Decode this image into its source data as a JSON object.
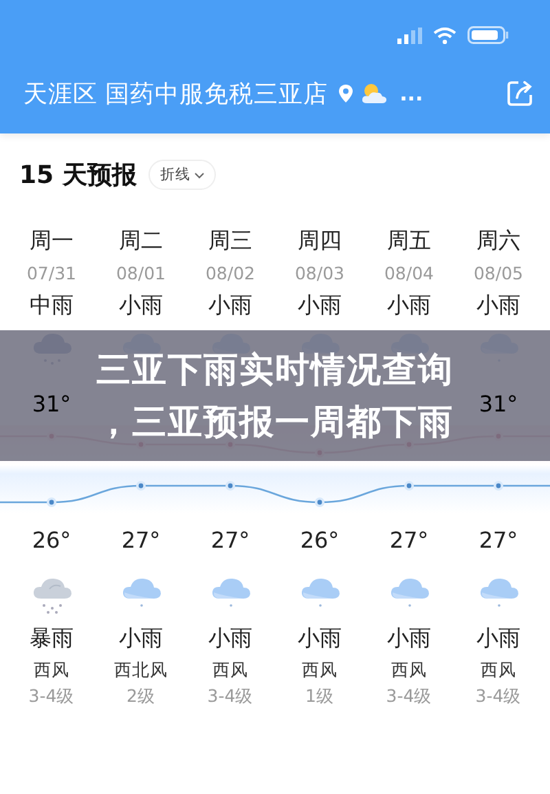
{
  "header": {
    "location": "天涯区 国药中服免税三亚店",
    "more": "..."
  },
  "forecast": {
    "title": "15 天预报",
    "mode": "折线",
    "days": [
      {
        "weekday": "周一",
        "date": "07/31",
        "day_condition": "中雨",
        "day_icon": {
          "kind": "rain"
        },
        "high": "31°",
        "low": "26°",
        "night_icon": {
          "kind": "storm"
        },
        "night_condition": "暴雨",
        "wind": "西风",
        "wind_level": "3-4级"
      },
      {
        "weekday": "周二",
        "date": "08/01",
        "day_condition": "小雨",
        "day_icon": {
          "kind": "light-rain"
        },
        "low": "27°",
        "night_icon": {
          "kind": "light-rain"
        },
        "night_condition": "小雨",
        "wind": "西北风",
        "wind_level": "2级"
      },
      {
        "weekday": "周三",
        "date": "08/02",
        "day_condition": "小雨",
        "day_icon": {
          "kind": "light-rain"
        },
        "low": "27°",
        "night_icon": {
          "kind": "light-rain"
        },
        "night_condition": "小雨",
        "wind": "西风",
        "wind_level": "3-4级"
      },
      {
        "weekday": "周四",
        "date": "08/03",
        "day_condition": "小雨",
        "day_icon": {
          "kind": "light-rain"
        },
        "low": "26°",
        "night_icon": {
          "kind": "light-rain"
        },
        "night_condition": "小雨",
        "wind": "西风",
        "wind_level": "1级"
      },
      {
        "weekday": "周五",
        "date": "08/04",
        "day_condition": "小雨",
        "day_icon": {
          "kind": "light-rain"
        },
        "low": "27°",
        "night_icon": {
          "kind": "light-rain"
        },
        "night_condition": "小雨",
        "wind": "西风",
        "wind_level": "3-4级"
      },
      {
        "weekday": "周六",
        "date": "08/05",
        "day_condition": "小雨",
        "day_icon": {
          "kind": "light-rain"
        },
        "high": "31°",
        "low": "27°",
        "night_icon": {
          "kind": "light-rain"
        },
        "night_condition": "小雨",
        "wind": "西风",
        "wind_level": "3-4级"
      }
    ]
  },
  "banner": {
    "lines": [
      "三亚下雨实时情况查询",
      "，三亚预报一周都下雨"
    ]
  }
}
